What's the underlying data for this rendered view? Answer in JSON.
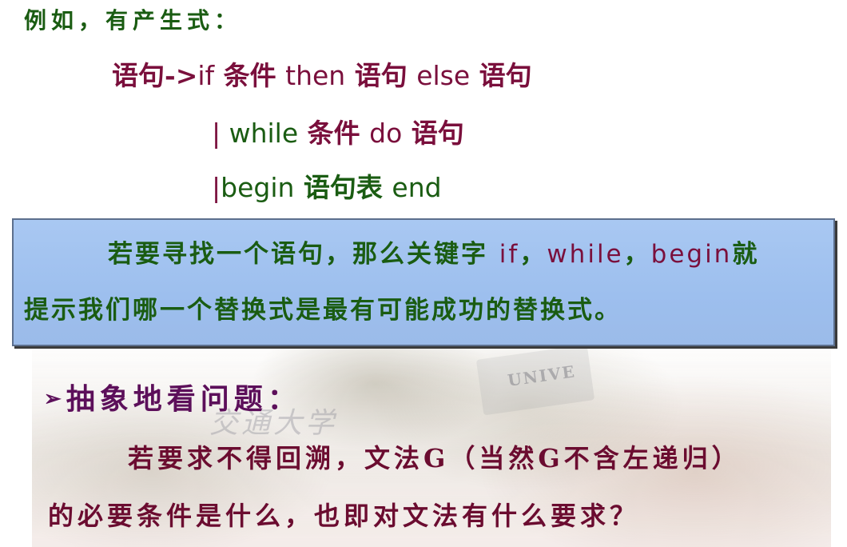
{
  "intro": "例如，有产生式：",
  "productions": [
    {
      "lhs": "语句->",
      "kw1": "if",
      "mid1": " 条件 ",
      "kw2": "then",
      "mid2": " 语句 ",
      "kw3": "else",
      "mid3": " 语句"
    },
    {
      "bar": "| ",
      "kw1": "while",
      "mid1": " 条件 ",
      "kw2": "do",
      "mid2": " 语句"
    },
    {
      "bar": "|",
      "kw1": "begin",
      "mid1": " 语句表 ",
      "kw2": "end"
    }
  ],
  "callout": {
    "line1_prefix": "若要寻找一个语句，那么关键字 ",
    "kw_if": "if",
    "sep1": "，",
    "kw_while": "while",
    "sep2": "，",
    "kw_begin": "begin",
    "line1_suffix": "就",
    "line2": "提示我们哪一个替换式是最有可能成功的替换式。"
  },
  "heading": {
    "bullet": "➢",
    "text": "抽象地看问题："
  },
  "question": {
    "line1": "若要求不得回溯，文法G（当然G不含左递归）",
    "line2": "的必要条件是什么，也即对文法有什么要求？"
  },
  "background": {
    "sign_text": "UNIVE",
    "calligraphy": "交通大学"
  },
  "colors": {
    "green_text": "#1a5c12",
    "maroon_text": "#7a0f3c",
    "callout_fill": "#a9c8f2",
    "heading_purple": "#5c0f5a"
  }
}
